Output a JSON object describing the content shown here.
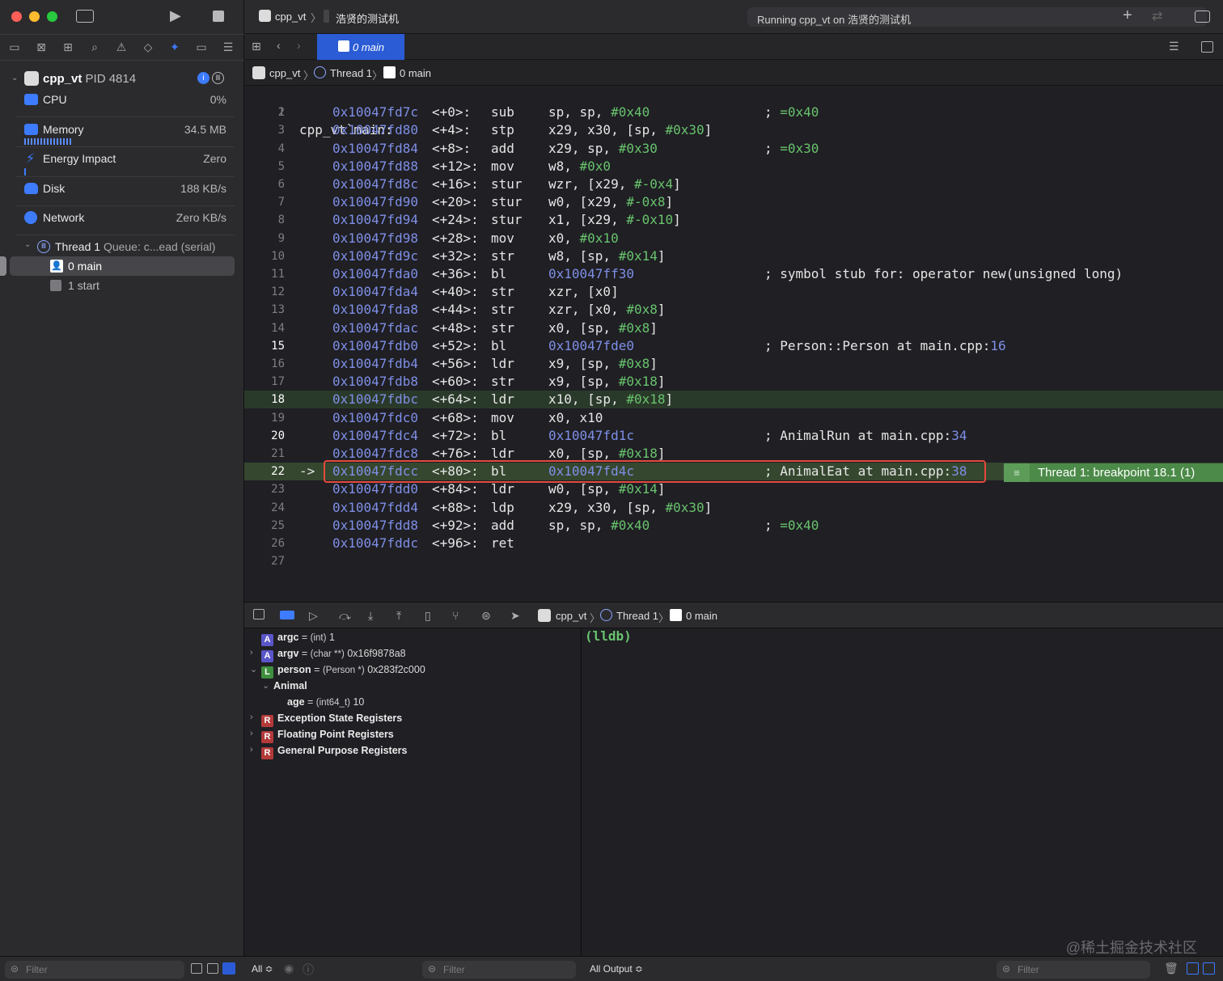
{
  "toolbar": {
    "scheme": "cpp_vt",
    "destination": "浩贤的测试机",
    "status": "Running cpp_vt on 浩贤的测试机"
  },
  "editor_tab": {
    "label": "0 main"
  },
  "debug_nav": {
    "process_name": "cpp_vt",
    "process_pid": "PID 4814",
    "gauges": [
      {
        "label": "CPU",
        "value": "0%"
      },
      {
        "label": "Memory",
        "value": "34.5 MB"
      },
      {
        "label": "Energy Impact",
        "value": "Zero"
      },
      {
        "label": "Disk",
        "value": "188 KB/s"
      },
      {
        "label": "Network",
        "value": "Zero KB/s"
      }
    ],
    "thread_name": "Thread 1",
    "thread_queue": "Queue: c...ead (serial)",
    "frames": [
      "0 main",
      "1 start"
    ],
    "filter_placeholder": "Filter"
  },
  "jump_bar": {
    "project": "cpp_vt",
    "thread": "Thread 1",
    "frame": "0 main"
  },
  "code": {
    "header": "cpp_vt`main:",
    "lines": [
      {
        "n": "1",
        "addr": "",
        "off": "",
        "mn": "",
        "op": "",
        "cm": ""
      },
      {
        "n": "2",
        "addr": "0x10047fd7c",
        "off": "<+0>:",
        "mn": "sub",
        "op": "sp, sp, ",
        "imm": "#0x40",
        "cm": "; =0x40"
      },
      {
        "n": "3",
        "addr": "0x10047fd80",
        "off": "<+4>:",
        "mn": "stp",
        "op": "x29, x30, [sp, ",
        "imm": "#0x30",
        "tail": "]",
        "cm": ""
      },
      {
        "n": "4",
        "addr": "0x10047fd84",
        "off": "<+8>:",
        "mn": "add",
        "op": "x29, sp, ",
        "imm": "#0x30",
        "cm": "; =0x30"
      },
      {
        "n": "5",
        "addr": "0x10047fd88",
        "off": "<+12>:",
        "mn": "mov",
        "op": "w8, ",
        "imm": "#0x0",
        "cm": ""
      },
      {
        "n": "6",
        "addr": "0x10047fd8c",
        "off": "<+16>:",
        "mn": "stur",
        "op": "wzr, [x29, ",
        "imm": "#-0x4",
        "tail": "]",
        "cm": ""
      },
      {
        "n": "7",
        "addr": "0x10047fd90",
        "off": "<+20>:",
        "mn": "stur",
        "op": "w0, [x29, ",
        "imm": "#-0x8",
        "tail": "]",
        "cm": ""
      },
      {
        "n": "8",
        "addr": "0x10047fd94",
        "off": "<+24>:",
        "mn": "stur",
        "op": "x1, [x29, ",
        "imm": "#-0x10",
        "tail": "]",
        "cm": ""
      },
      {
        "n": "9",
        "addr": "0x10047fd98",
        "off": "<+28>:",
        "mn": "mov",
        "op": "x0, ",
        "imm": "#0x10",
        "cm": ""
      },
      {
        "n": "10",
        "addr": "0x10047fd9c",
        "off": "<+32>:",
        "mn": "str",
        "op": "w8, [sp, ",
        "imm": "#0x14",
        "tail": "]",
        "cm": ""
      },
      {
        "n": "11",
        "addr": "0x10047fda0",
        "off": "<+36>:",
        "mn": "bl",
        "op": "",
        "target": "0x10047ff30",
        "cm": "; symbol stub for: operator new(unsigned long)"
      },
      {
        "n": "12",
        "addr": "0x10047fda4",
        "off": "<+40>:",
        "mn": "str",
        "op": "xzr, [x0]",
        "cm": ""
      },
      {
        "n": "13",
        "addr": "0x10047fda8",
        "off": "<+44>:",
        "mn": "str",
        "op": "xzr, [x0, ",
        "imm": "#0x8",
        "tail": "]",
        "cm": ""
      },
      {
        "n": "14",
        "addr": "0x10047fdac",
        "off": "<+48>:",
        "mn": "str",
        "op": "x0, [sp, ",
        "imm": "#0x8",
        "tail": "]",
        "cm": ""
      },
      {
        "n": "15",
        "addr": "0x10047fdb0",
        "off": "<+52>:",
        "mn": "bl",
        "op": "",
        "target": "0x10047fde0",
        "cm": "; Person::Person at main.cpp:",
        "cmnum": "16"
      },
      {
        "n": "16",
        "addr": "0x10047fdb4",
        "off": "<+56>:",
        "mn": "ldr",
        "op": "x9, [sp, ",
        "imm": "#0x8",
        "tail": "]",
        "cm": ""
      },
      {
        "n": "17",
        "addr": "0x10047fdb8",
        "off": "<+60>:",
        "mn": "str",
        "op": "x9, [sp, ",
        "imm": "#0x18",
        "tail": "]",
        "cm": ""
      },
      {
        "n": "18",
        "addr": "0x10047fdbc",
        "off": "<+64>:",
        "mn": "ldr",
        "op": "x10, [sp, ",
        "imm": "#0x18",
        "tail": "]",
        "cm": ""
      },
      {
        "n": "19",
        "addr": "0x10047fdc0",
        "off": "<+68>:",
        "mn": "mov",
        "op": "x0, x10",
        "cm": ""
      },
      {
        "n": "20",
        "addr": "0x10047fdc4",
        "off": "<+72>:",
        "mn": "bl",
        "op": "",
        "target": "0x10047fd1c",
        "cm": "; AnimalRun at main.cpp:",
        "cmnum": "34"
      },
      {
        "n": "21",
        "addr": "0x10047fdc8",
        "off": "<+76>:",
        "mn": "ldr",
        "op": "x0, [sp, ",
        "imm": "#0x18",
        "tail": "]",
        "cm": ""
      },
      {
        "n": "22",
        "addr": "0x10047fdcc",
        "off": "<+80>:",
        "mn": "bl",
        "op": "",
        "target": "0x10047fd4c",
        "cm": "; AnimalEat at main.cpp:",
        "cmnum": "38"
      },
      {
        "n": "23",
        "addr": "0x10047fdd0",
        "off": "<+84>:",
        "mn": "ldr",
        "op": "w0, [sp, ",
        "imm": "#0x14",
        "tail": "]",
        "cm": ""
      },
      {
        "n": "24",
        "addr": "0x10047fdd4",
        "off": "<+88>:",
        "mn": "ldp",
        "op": "x29, x30, [sp, ",
        "imm": "#0x30",
        "tail": "]",
        "cm": ""
      },
      {
        "n": "25",
        "addr": "0x10047fdd8",
        "off": "<+92>:",
        "mn": "add",
        "op": "sp, sp, ",
        "imm": "#0x40",
        "cm": "; =0x40"
      },
      {
        "n": "26",
        "addr": "0x10047fddc",
        "off": "<+96>:",
        "mn": "ret",
        "op": "",
        "cm": ""
      },
      {
        "n": "27",
        "addr": "",
        "off": "",
        "mn": "",
        "op": "",
        "cm": ""
      }
    ],
    "pc_marker": "->",
    "breakpoint_label": "Thread 1: breakpoint 18.1 (1)"
  },
  "debug_bar": {
    "project": "cpp_vt",
    "thread": "Thread 1",
    "frame": "0 main"
  },
  "variables": [
    {
      "badge": "A",
      "name": "argc",
      "type": "(int)",
      "value": "1"
    },
    {
      "badge": "A",
      "name": "argv",
      "type": "(char **)",
      "value": "0x16f9878a8"
    },
    {
      "badge": "L",
      "name": "person",
      "type": "(Person *)",
      "value": "0x283f2c000"
    },
    {
      "name": "Animal"
    },
    {
      "name": "age",
      "type": "(int64_t)",
      "value": "10"
    },
    {
      "badge": "R",
      "name": "Exception State Registers"
    },
    {
      "badge": "R",
      "name": "Floating Point Registers"
    },
    {
      "badge": "R",
      "name": "General Purpose Registers"
    }
  ],
  "console": {
    "prompt": "(lldb)",
    "watermark": "@稀土掘金技术社区"
  },
  "bottom": {
    "scope": "All ≎",
    "var_filter": "Filter",
    "output": "All Output ≎",
    "console_filter": "Filter"
  },
  "colors": {
    "accent": "#2b5cd6",
    "breakpoint": "#4b8a48",
    "highlight_box": "#e5493c",
    "immediate": "#69c36d",
    "address": "#7f8fe6"
  }
}
